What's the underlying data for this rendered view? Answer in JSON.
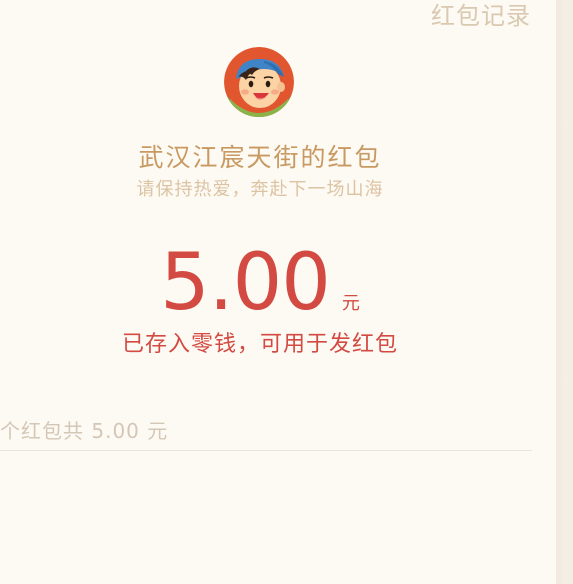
{
  "header": {
    "records_link": "红包记录"
  },
  "packet": {
    "sender": "武汉江宸天街的红包",
    "blessing": "请保持热爱，奔赴下一场山海",
    "amount": "5.00",
    "unit": "元",
    "status_link": "已存入零钱，可用于发红包"
  },
  "summary": {
    "text": "个红包共 5.00 元"
  },
  "colors": {
    "background": "#fdf9f3",
    "accent_red": "#d24a42",
    "gold": "#c89a61",
    "muted": "#dcc4a3"
  },
  "icons": {
    "avatar": "cartoon-boy-avatar"
  }
}
